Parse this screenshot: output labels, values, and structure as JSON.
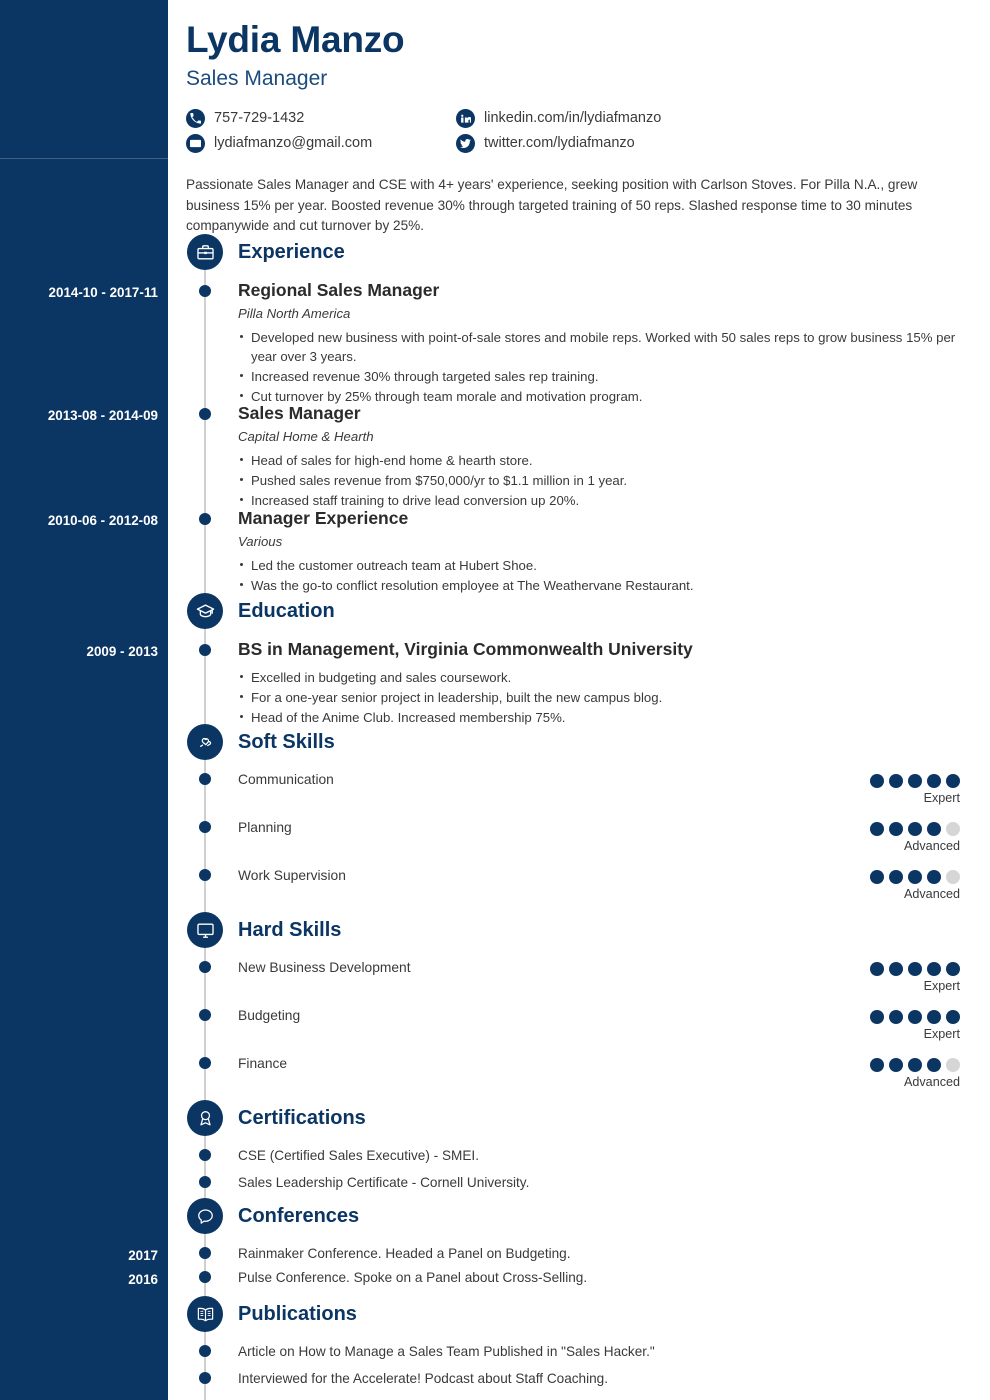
{
  "colors": {
    "navy": "#0b3563",
    "sidebar_bg": "#0b3563",
    "rail": "#cfcfcf",
    "dot_on": "#0b3563",
    "dot_off": "#d6d6d6",
    "body_text": "#3a3a3a"
  },
  "header": {
    "name": "Lydia Manzo",
    "job_title": "Sales Manager",
    "contacts": {
      "phone": "757-729-1432",
      "email": "lydiafmanzo@gmail.com",
      "linkedin": "linkedin.com/in/lydiafmanzo",
      "twitter": "twitter.com/lydiafmanzo"
    }
  },
  "summary": "Passionate Sales Manager and CSE with 4+ years' experience, seeking position with Carlson Stoves. For Pilla N.A., grew business 15% per year. Boosted revenue 30% through targeted training of 50 reps. Slashed response time to 30 minutes companywide and cut turnover by 25%.",
  "sections": {
    "experience": {
      "title": "Experience",
      "icon": "briefcase-icon",
      "entries": [
        {
          "date": "2014-10 - 2017-11",
          "title": "Regional Sales Manager",
          "company": "Pilla North America",
          "bullets": [
            "Developed new business with point-of-sale stores and mobile reps. Worked with 50 sales reps to grow business 15% per year over 3 years.",
            "Increased revenue 30% through targeted sales rep training.",
            "Cut turnover by 25% through team morale and motivation program."
          ]
        },
        {
          "date": "2013-08 - 2014-09",
          "title": "Sales Manager",
          "company": "Capital Home & Hearth",
          "bullets": [
            "Head of sales for high-end home & hearth store.",
            "Pushed sales revenue from $750,000/yr to $1.1 million in 1 year.",
            "Increased staff training to drive lead conversion up 20%."
          ]
        },
        {
          "date": "2010-06 - 2012-08",
          "title": "Manager Experience",
          "company": "Various",
          "bullets": [
            "Led the customer outreach team at Hubert Shoe.",
            "Was the go-to conflict resolution employee at The Weathervane Restaurant."
          ]
        }
      ]
    },
    "education": {
      "title": "Education",
      "icon": "graduation-cap-icon",
      "entries": [
        {
          "date": "2009 - 2013",
          "title": "BS in Management, Virginia Commonwealth University",
          "bullets": [
            "Excelled in budgeting and sales coursework.",
            "For a one-year senior project in leadership, built the new campus blog.",
            "Head of the Anime Club. Increased membership 75%."
          ]
        }
      ]
    },
    "soft_skills": {
      "title": "Soft Skills",
      "icon": "handshake-heart-icon",
      "items": [
        {
          "name": "Communication",
          "filled": 5,
          "total": 5,
          "level": "Expert"
        },
        {
          "name": "Planning",
          "filled": 4,
          "total": 5,
          "level": "Advanced"
        },
        {
          "name": "Work Supervision",
          "filled": 4,
          "total": 5,
          "level": "Advanced"
        }
      ]
    },
    "hard_skills": {
      "title": "Hard Skills",
      "icon": "monitor-icon",
      "items": [
        {
          "name": "New Business Development",
          "filled": 5,
          "total": 5,
          "level": "Expert"
        },
        {
          "name": "Budgeting",
          "filled": 5,
          "total": 5,
          "level": "Expert"
        },
        {
          "name": "Finance",
          "filled": 4,
          "total": 5,
          "level": "Advanced"
        }
      ]
    },
    "certifications": {
      "title": "Certifications",
      "icon": "award-ribbon-icon",
      "items": [
        {
          "date": "",
          "text": "CSE (Certified Sales Executive) - SMEI."
        },
        {
          "date": "",
          "text": "Sales Leadership Certificate - Cornell University."
        }
      ]
    },
    "conferences": {
      "title": "Conferences",
      "icon": "speech-bubble-icon",
      "items": [
        {
          "date": "2017",
          "text": "Rainmaker Conference. Headed a Panel on Budgeting."
        },
        {
          "date": "2016",
          "text": "Pulse Conference. Spoke on a Panel about Cross-Selling."
        }
      ]
    },
    "publications": {
      "title": "Publications",
      "icon": "open-book-icon",
      "items": [
        {
          "date": "",
          "text": "Article on How to Manage a Sales Team Published in \"Sales Hacker.\""
        },
        {
          "date": "",
          "text": "Interviewed for the Accelerate! Podcast about Staff Coaching."
        }
      ]
    }
  }
}
